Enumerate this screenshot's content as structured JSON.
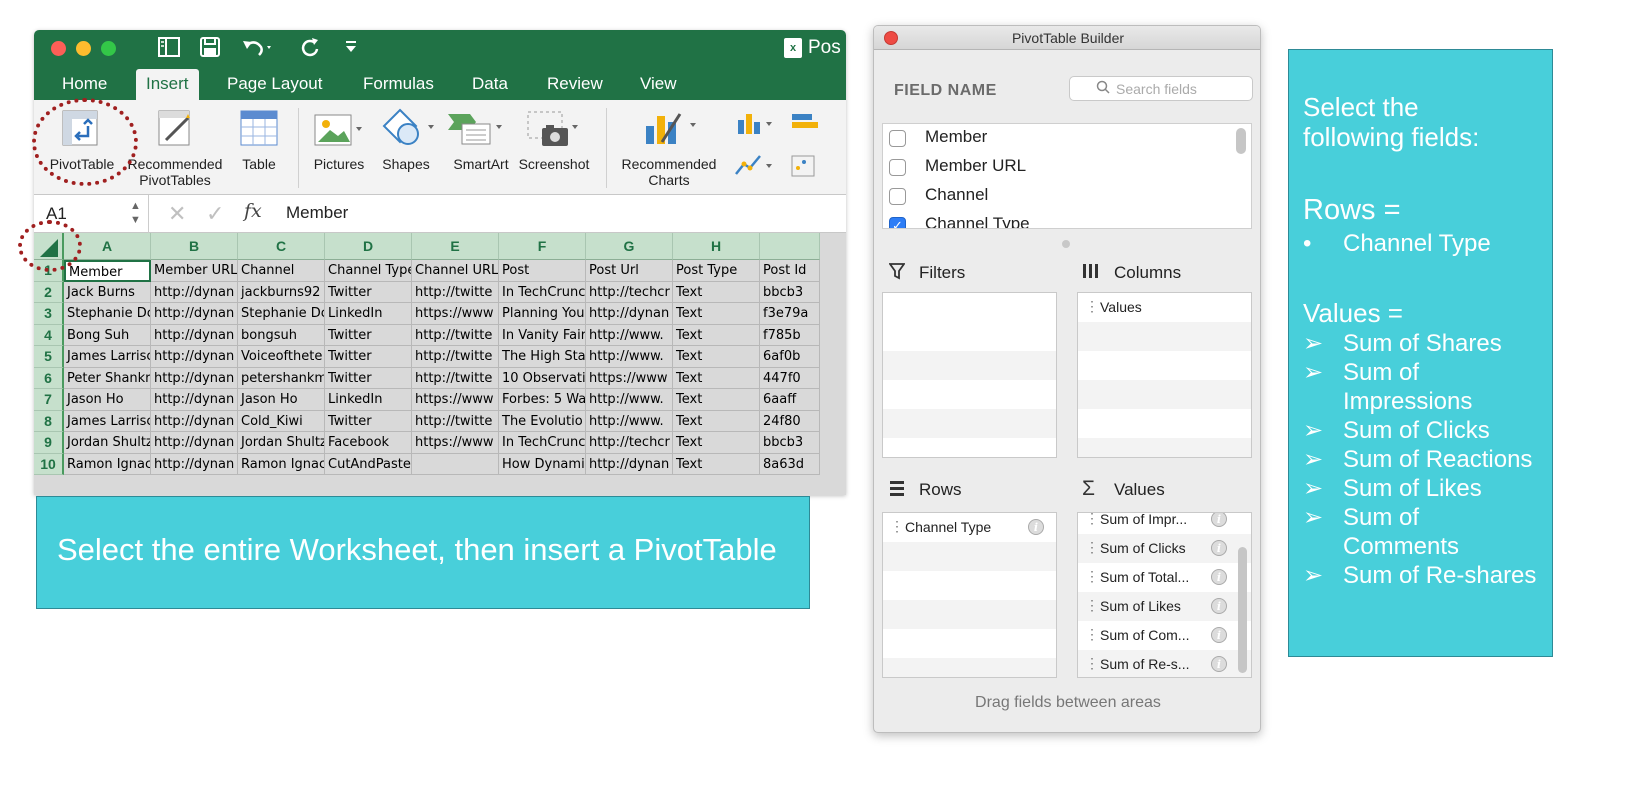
{
  "excel": {
    "doc_title": "Pos",
    "tabs": [
      "Home",
      "Insert",
      "Page Layout",
      "Formulas",
      "Data",
      "Review",
      "View"
    ],
    "active_tab": "Insert",
    "ribbon": {
      "pivottable": "PivotTable",
      "recommended_pivottables_1": "Recommended",
      "recommended_pivottables_2": "PivotTables",
      "table": "Table",
      "pictures": "Pictures",
      "shapes": "Shapes",
      "smartart": "SmartArt",
      "screenshot": "Screenshot",
      "recommended_charts_1": "Recommended",
      "recommended_charts_2": "Charts"
    },
    "name_box": "A1",
    "fx": "fx",
    "formula_value": "Member",
    "columns": [
      "A",
      "B",
      "C",
      "D",
      "E",
      "F",
      "G",
      "H",
      ""
    ],
    "rows": [
      [
        "1",
        "Member",
        "Member URL",
        "Channel",
        "Channel Type",
        "Channel URL",
        "Post",
        "Post Url",
        "Post Type",
        "Post Id"
      ],
      [
        "2",
        "Jack Burns",
        "http://dynan",
        "jackburns92",
        "Twitter",
        "http://twitte",
        "In TechCrunc",
        "http://techcr",
        "Text",
        "bbcb3"
      ],
      [
        "3",
        "Stephanie Dc",
        "http://dynan",
        "Stephanie Dc",
        "LinkedIn",
        "https://www",
        "Planning You",
        "http://dynan",
        "Text",
        "f3e79a"
      ],
      [
        "4",
        "Bong Suh",
        "http://dynan",
        "bongsuh",
        "Twitter",
        "http://twitte",
        "In Vanity Fair",
        "http://www.",
        "Text",
        "f785b"
      ],
      [
        "5",
        "James Larrisc",
        "http://dynan",
        "Voiceofthete",
        "Twitter",
        "http://twitte",
        "The High Sta",
        "http://www.",
        "Text",
        "6af0b"
      ],
      [
        "6",
        "Peter Shankr",
        "http://dynan",
        "petershankm",
        "Twitter",
        "http://twitte",
        "10 Observati",
        "https://www",
        "Text",
        "447f0"
      ],
      [
        "7",
        "Jason Ho",
        "http://dynan",
        "Jason Ho",
        "LinkedIn",
        "https://www",
        "Forbes: 5 Wa",
        "http://www.",
        "Text",
        "6aaff"
      ],
      [
        "8",
        "James Larrisc",
        "http://dynan",
        "Cold_Kiwi",
        "Twitter",
        "http://twitte",
        "The Evolutio",
        "http://www.",
        "Text",
        "24f80"
      ],
      [
        "9",
        "Jordan Shultz",
        "http://dynan",
        "Jordan Shultz",
        "Facebook",
        "https://www",
        "In TechCrunc",
        "http://techcr",
        "Text",
        "bbcb3"
      ],
      [
        "10",
        "Ramon Ignac",
        "http://dynan",
        "Ramon Ignac",
        "CutAndPaste",
        "",
        "How Dynami",
        "http://dynan",
        "Text",
        "8a63d"
      ]
    ]
  },
  "instruction_left": "Select the entire Worksheet, then insert a PivotTable",
  "pivot_builder": {
    "title": "PivotTable Builder",
    "field_name": "FIELD NAME",
    "search_placeholder": "Search fields",
    "fields": [
      {
        "label": "Member",
        "checked": false
      },
      {
        "label": "Member URL",
        "checked": false
      },
      {
        "label": "Channel",
        "checked": false
      },
      {
        "label": "Channel Type",
        "checked": true
      }
    ],
    "filters_label": "Filters",
    "columns_label": "Columns",
    "rows_label": "Rows",
    "values_label": "Values",
    "columns_items": [
      "Values"
    ],
    "rows_items": [
      "Channel Type"
    ],
    "values_items": [
      "Sum of Impr...",
      "Sum of Clicks",
      "Sum of Total...",
      "Sum of Likes",
      "Sum of Com...",
      "Sum of Re-s..."
    ],
    "drag_hint": "Drag fields between areas"
  },
  "instruction_right": {
    "heading_1": "Select the",
    "heading_2": "following fields:",
    "rows_title": "Rows =",
    "rows_bullet": "•",
    "rows_item": "Channel Type",
    "values_title": "Values =",
    "values_bullet": "➢",
    "values_items": [
      "Sum of Shares",
      "Sum of",
      "Impressions",
      "Sum of Clicks",
      "Sum of Reactions",
      "Sum of Likes",
      "Sum of",
      "Comments",
      "Sum of Re-shares"
    ]
  },
  "colors": {
    "excel_green": "#207245",
    "teal": "#48cfda",
    "annotation_red": "#a02020",
    "check_blue": "#2d7df6"
  }
}
